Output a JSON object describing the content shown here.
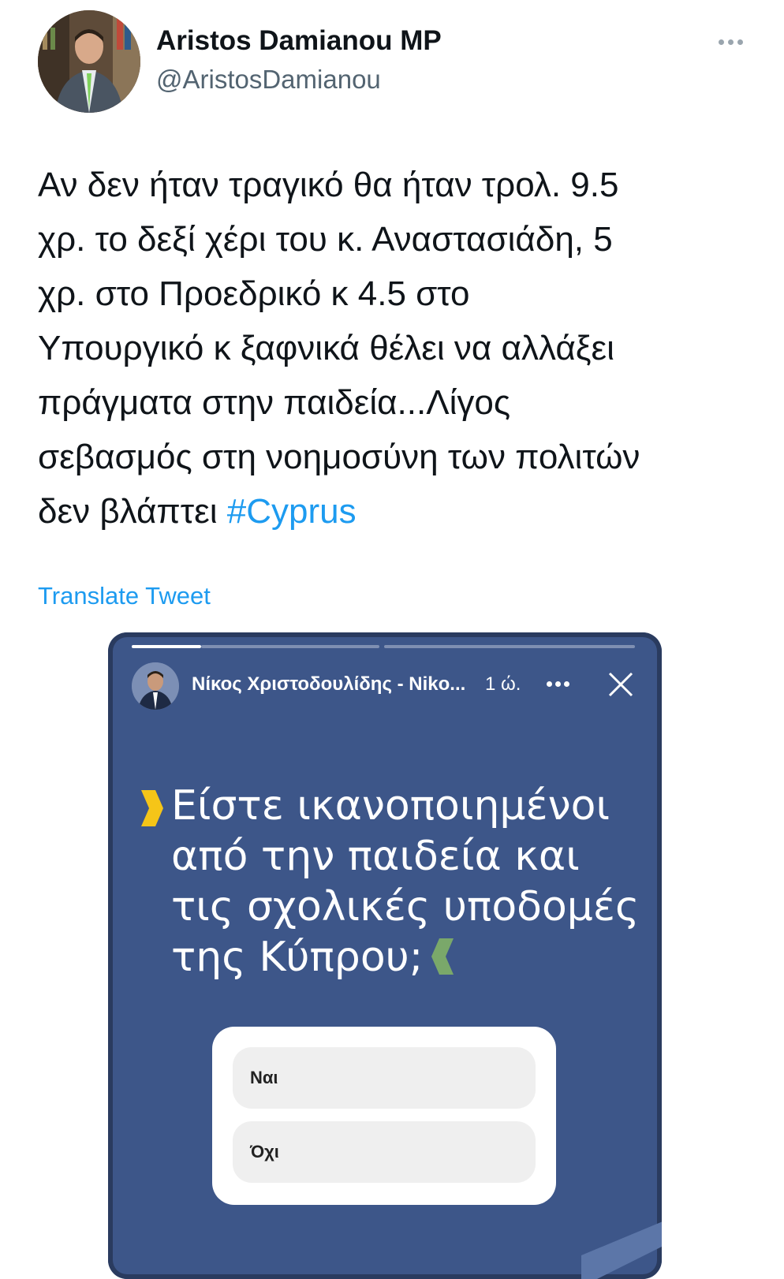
{
  "tweet": {
    "author": {
      "display_name": "Aristos Damianou MP",
      "handle": "@AristosDamianou"
    },
    "text_lines": [
      "Αν δεν ήταν τραγικό θα ήταν τρολ. 9.5",
      "χρ. το δεξί χέρι του κ. Αναστασιάδη, 5",
      "χρ. στο Προεδρικό κ 4.5 στο",
      "Υπουργικό κ ξαφνικά θέλει να αλλάξει",
      "πράγματα στην παιδεία...Λίγος",
      "σεβασμός στη νοημοσύνη των πολιτών"
    ],
    "last_line_text": "δεν βλάπτει ",
    "hashtag": "#Cyprus",
    "translate_label": "Translate Tweet",
    "more_icon": "more-horizontal-icon"
  },
  "story": {
    "author": "Νίκος Χριστοδουλίδης - Niko...",
    "time": "1 ώ.",
    "question_lines": [
      "Είστε ικανοποιημένοι",
      "από την παιδεία και",
      "τις σχολικές υποδομές",
      "της Κύπρου;"
    ],
    "poll_options": [
      "Ναι",
      "Όχι"
    ],
    "progress_first_segment": 0.28,
    "colors": {
      "background": "#3d5689",
      "quote_open": "#f5c518",
      "quote_close": "#7aa86a"
    }
  },
  "colors": {
    "link": "#1d9bf0",
    "text": "#0f1419",
    "secondary": "#536471"
  }
}
